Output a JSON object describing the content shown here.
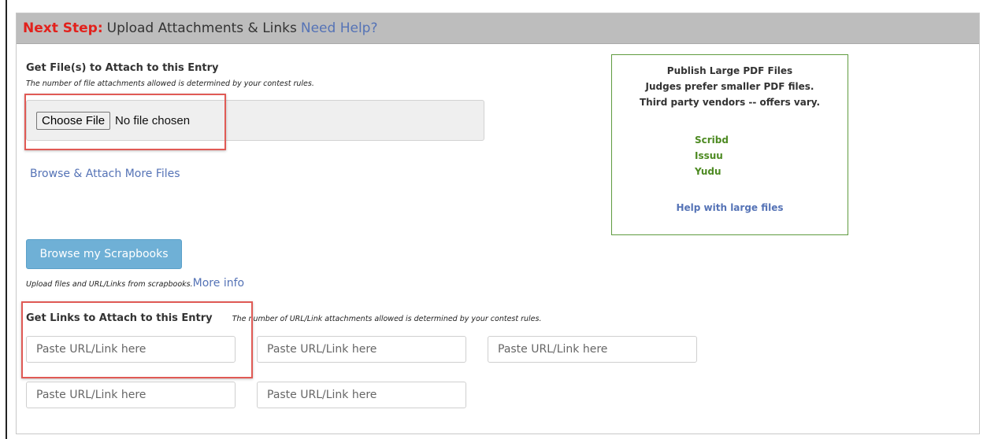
{
  "header": {
    "next_step": "Next Step:",
    "title": "Upload Attachments & Links",
    "help": "Need Help?"
  },
  "files": {
    "title": "Get File(s) to Attach to this Entry",
    "note": "The number of file attachments allowed is determined by your contest rules.",
    "choose_label": "Choose File",
    "no_file": "No file chosen",
    "browse_more": "Browse & Attach More Files"
  },
  "sidebar": {
    "line1": "Publish Large PDF Files",
    "line2": "Judges prefer smaller PDF files.",
    "line3": "Third party vendors  --  offers vary.",
    "vendors": [
      "Scribd",
      "Issuu",
      "Yudu"
    ],
    "help": "Help with large files"
  },
  "scrapbooks": {
    "button": "Browse my Scrapbooks",
    "note": "Upload files and URL/Links from scrapbooks.",
    "more_info": "More info"
  },
  "links": {
    "title": "Get Links to Attach to this Entry",
    "note": "The number of URL/Link attachments allowed is determined by your contest rules.",
    "placeholder": "Paste URL/Link here"
  },
  "colors": {
    "accent_red": "#e2211c",
    "link_blue": "#5573b6",
    "vendor_green": "#4d8a22",
    "button_blue": "#6fb0d6"
  }
}
